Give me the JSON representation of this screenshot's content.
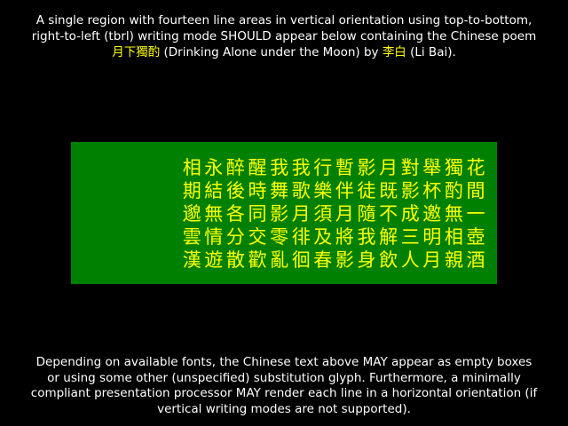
{
  "intro": {
    "line1": "A single region with fourteen line areas in vertical orientation using top-to-bottom,",
    "line2": "right-to-left (tbrl) writing mode SHOULD appear below containing the Chinese poem",
    "poem_title": "月下獨酌",
    "mid": " (Drinking Alone under the Moon) by ",
    "poet": "李白",
    "end": " (Li Bai)."
  },
  "poem": {
    "lines": [
      "花間一壺酒",
      "獨酌無相親",
      "舉杯邀明月",
      "對影成三人",
      "月既不解飲",
      "影徒隨我身",
      "暫伴月將影",
      "行樂須及春",
      "我歌月徘徊",
      "我舞影零亂",
      "醒時同交歡",
      "醉後各分散",
      "永結無情遊",
      "相期邈雲漢"
    ]
  },
  "outro": {
    "line1": "Depending on available fonts, the Chinese text above MAY appear as empty boxes",
    "line2": "or using some other (unspecified) substitution glyph. Furthermore, a minimally",
    "line3": "compliant presentation processor MAY render each line in a horizontal orientation (if",
    "line4": "vertical writing modes are not supported)."
  },
  "colors": {
    "background": "#000000",
    "region": "#008000",
    "poem_text": "#ffff00",
    "body_text": "#ffffff"
  }
}
